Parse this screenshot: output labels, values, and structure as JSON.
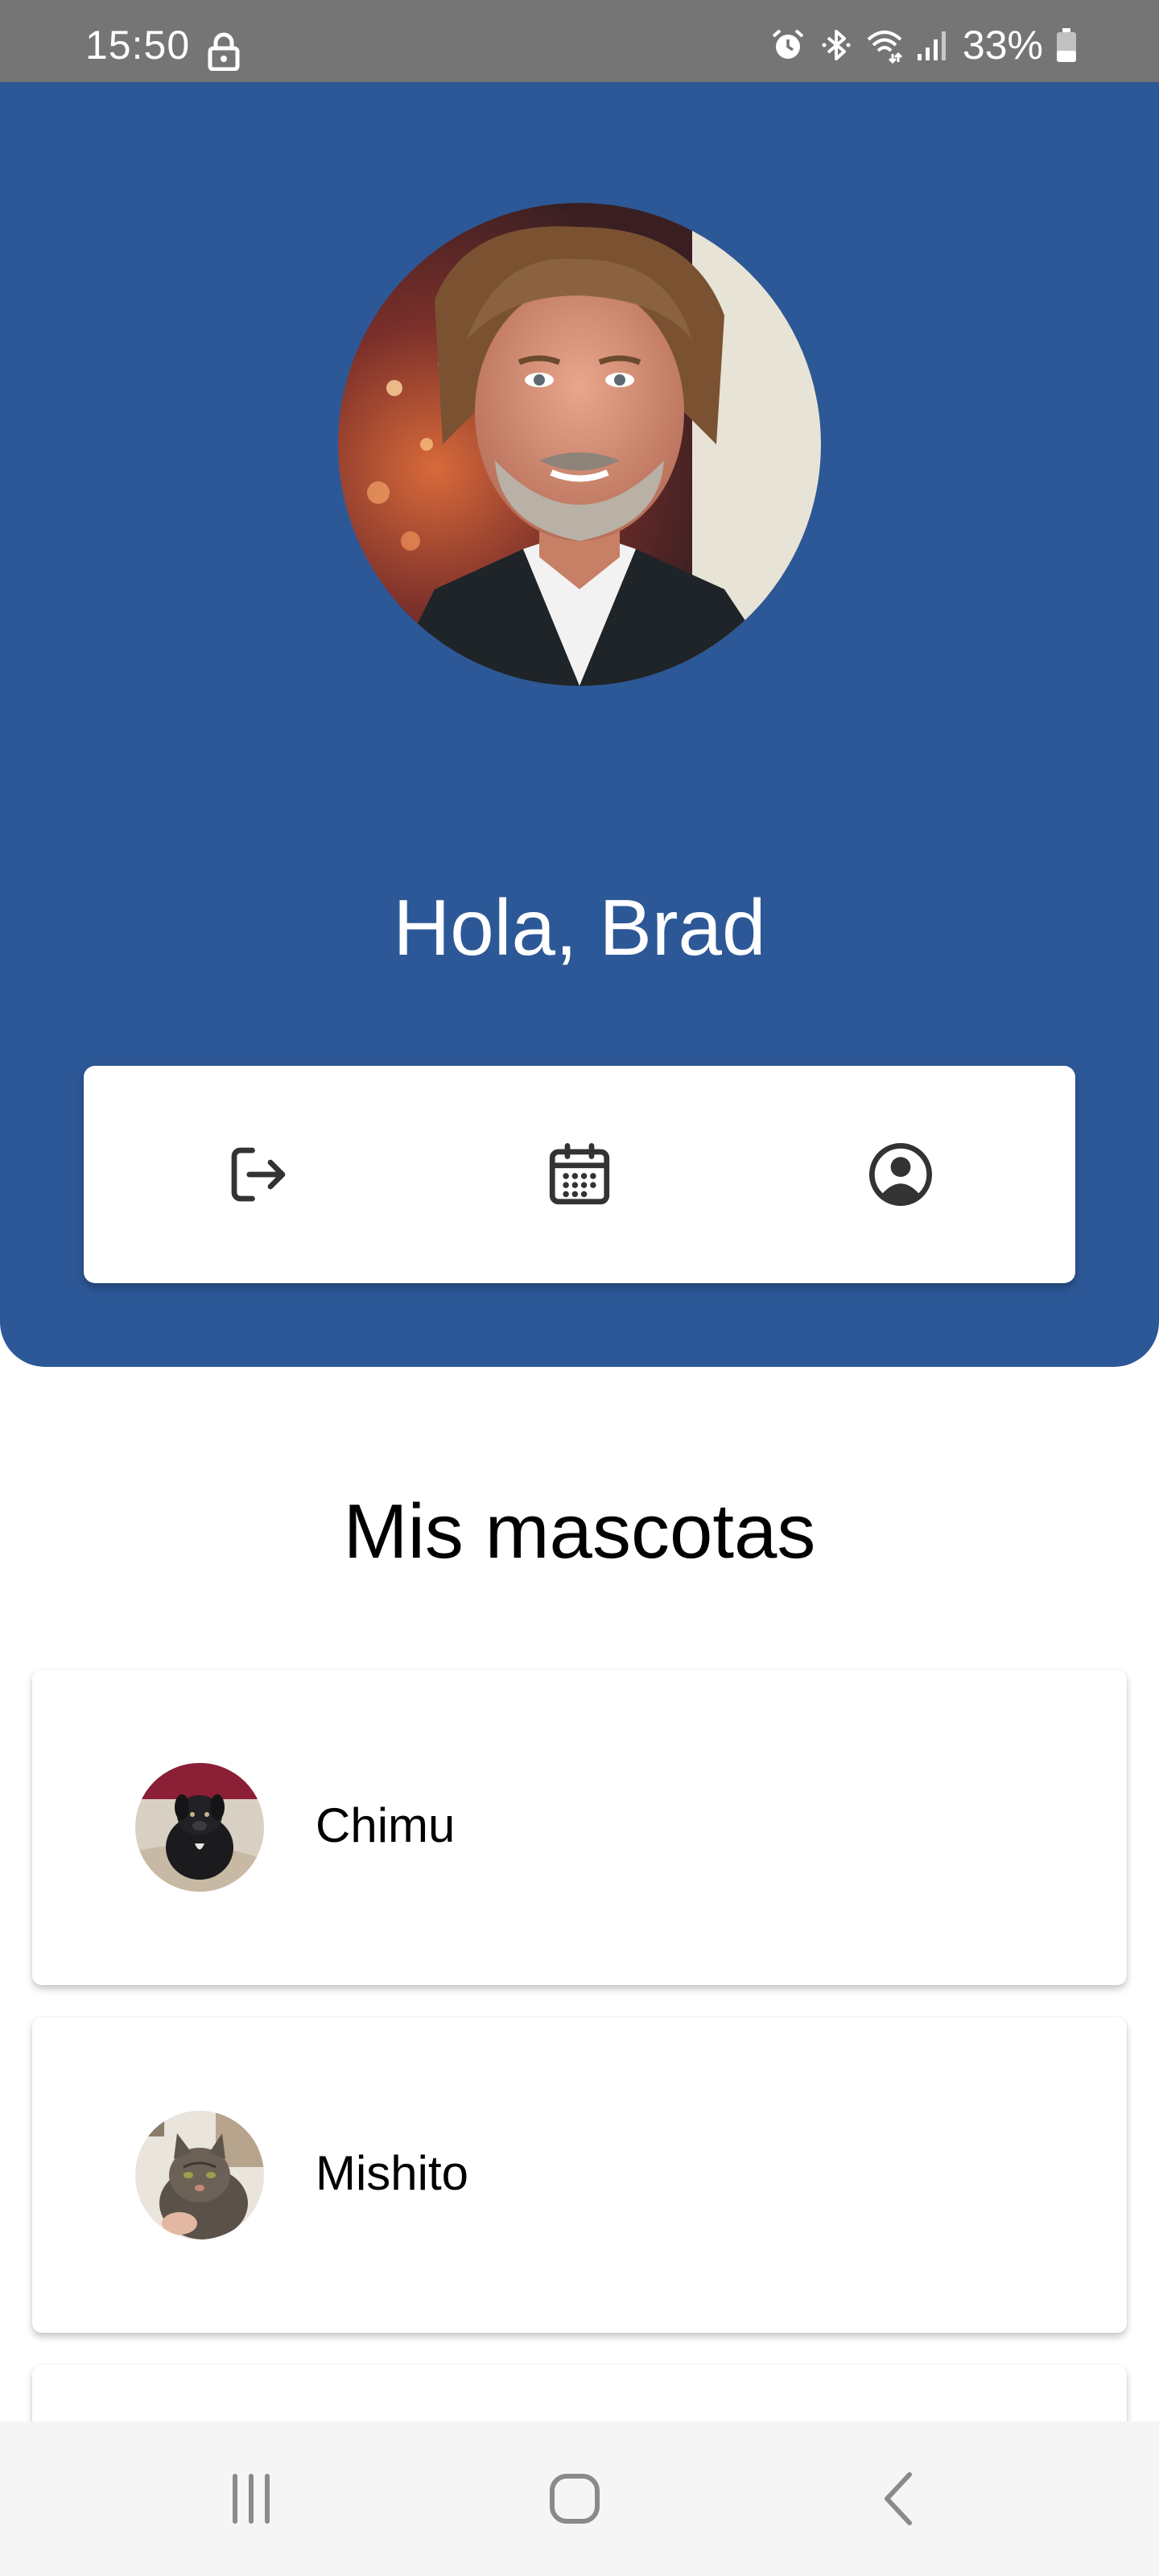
{
  "status_bar": {
    "time": "15:50",
    "battery": "33%",
    "icons": [
      "lock-icon",
      "alarm-icon",
      "bluetooth-icon",
      "wifi-icon",
      "signal-icon",
      "battery-icon"
    ]
  },
  "header": {
    "greeting": "Hola, Brad",
    "background_color": "#2d5897",
    "actions": [
      {
        "icon": "logout-icon"
      },
      {
        "icon": "calendar-icon"
      },
      {
        "icon": "profile-icon"
      }
    ]
  },
  "pets_section": {
    "title": "Mis mascotas",
    "pets": [
      {
        "name": "Chimu"
      },
      {
        "name": "Mishito"
      },
      {
        "name": ""
      }
    ]
  },
  "nav_bar": {
    "buttons": [
      "recent-apps-icon",
      "home-icon",
      "back-icon"
    ]
  }
}
